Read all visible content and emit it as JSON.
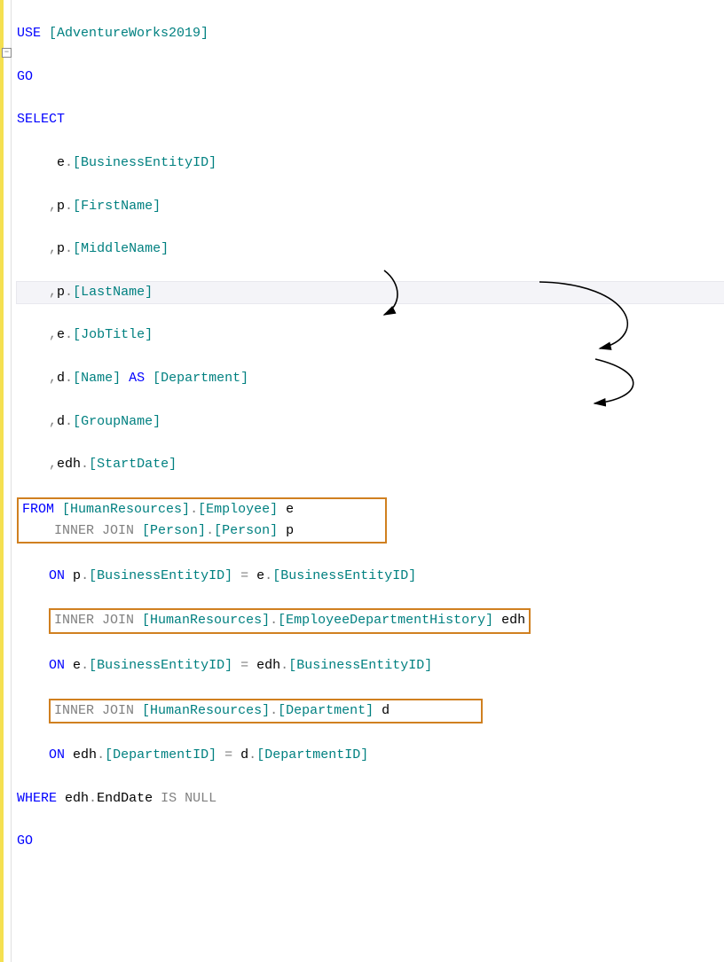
{
  "code": {
    "use": "USE",
    "db": "[AdventureWorks2019]",
    "go1": "GO",
    "select": "SELECT",
    "col1_alias": "e",
    "col1_name": "[BusinessEntityID]",
    "col2_alias": "p",
    "col2_name": "[FirstName]",
    "col3_alias": "p",
    "col3_name": "[MiddleName]",
    "col4_alias": "p",
    "col4_name": "[LastName]",
    "col5_alias": "e",
    "col5_name": "[JobTitle]",
    "col6_alias": "d",
    "col6_name": "[Name]",
    "as": "AS",
    "col6_as": "[Department]",
    "col7_alias": "d",
    "col7_name": "[GroupName]",
    "col8_alias": "edh",
    "col8_name": "[StartDate]",
    "from": "FROM",
    "from_schema": "[HumanResources]",
    "from_table": "[Employee]",
    "from_alias": "e",
    "join1": "INNER JOIN",
    "join1_schema": "[Person]",
    "join1_table": "[Person]",
    "join1_alias": "p",
    "on1": "ON",
    "on1_left_a": "p",
    "on1_left_c": "[BusinessEntityID]",
    "on1_right_a": "e",
    "on1_right_c": "[BusinessEntityID]",
    "join2": "INNER JOIN",
    "join2_schema": "[HumanResources]",
    "join2_table": "[EmployeeDepartmentHistory]",
    "join2_alias": "edh",
    "on2": "ON",
    "on2_left_a": "e",
    "on2_left_c": "[BusinessEntityID]",
    "on2_right_a": "edh",
    "on2_right_c": "[BusinessEntityID]",
    "join3": "INNER JOIN",
    "join3_schema": "[HumanResources]",
    "join3_table": "[Department]",
    "join3_alias": "d",
    "on3": "ON",
    "on3_left_a": "edh",
    "on3_left_c": "[DepartmentID]",
    "on3_right_a": "d",
    "on3_right_c": "[DepartmentID]",
    "where": "WHERE",
    "where_a": "edh",
    "where_c": "EndDate",
    "isnull": "IS NULL",
    "go2": "GO",
    "collapse": "−"
  },
  "punct": {
    "dot": ".",
    "comma": ",",
    "eq": "=",
    "sp": " "
  }
}
